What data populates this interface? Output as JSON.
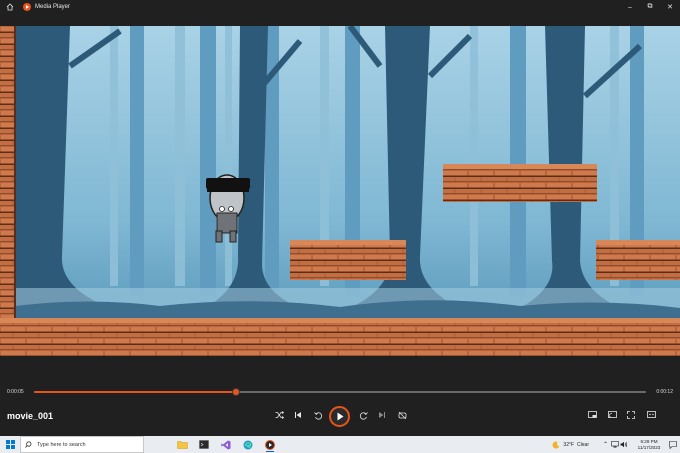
{
  "window": {
    "title": "Media Player",
    "controls": [
      "minimize",
      "maximize",
      "close"
    ]
  },
  "player": {
    "current_time": "0:00:05",
    "duration": "0:00:12",
    "progress": 0.33,
    "file_name": "movie_001",
    "accent_color": "#e8541c",
    "buttons": [
      "shuffle-icon",
      "previous-icon",
      "rewind-10-icon",
      "play-icon",
      "forward-30-icon",
      "next-icon",
      "repeat-icon",
      "miniplayer-icon",
      "cast-icon",
      "fullscreen-icon",
      "more-icon"
    ]
  },
  "taskbar": {
    "search_placeholder": "Type here to search",
    "weather_temp": "32°F",
    "weather_desc": "Clear",
    "time": "6:28 PM",
    "date": "11/17/2023",
    "pinned_apps": [
      "file-explorer-icon",
      "terminal-icon",
      "visual-studio-icon",
      "edge-icon",
      "media-player-icon"
    ]
  }
}
